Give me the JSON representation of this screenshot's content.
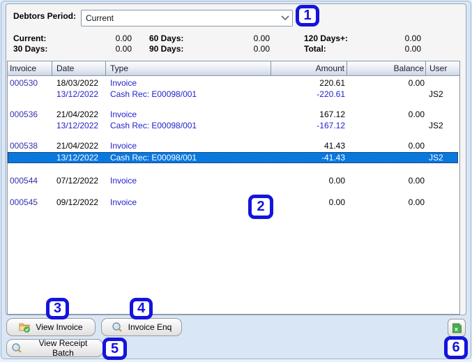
{
  "period_selector": {
    "label": "Debtors Period:",
    "value": "Current",
    "chevron_icon": "chevron-down-icon"
  },
  "summary": {
    "rows": [
      [
        {
          "label": "Current:",
          "value": "0.00"
        },
        {
          "label": "60 Days:",
          "value": "0.00"
        },
        {
          "label": "120 Days+:",
          "value": "0.00"
        }
      ],
      [
        {
          "label": "30 Days:",
          "value": "0.00"
        },
        {
          "label": "90 Days:",
          "value": "0.00"
        },
        {
          "label": "Total:",
          "value": "0.00"
        }
      ]
    ]
  },
  "table": {
    "columns": [
      "Invoice",
      "Date",
      "Type",
      "Amount",
      "Balance",
      "User"
    ],
    "rows": [
      {
        "invoice": "000530",
        "date": "18/03/2022",
        "type": "Invoice",
        "amount": "220.61",
        "balance": "0.00",
        "user": ""
      },
      {
        "invoice": "",
        "date": "13/12/2022",
        "type": "Cash Rec: E00098/001",
        "amount": "-220.61",
        "balance": "",
        "user": "JS2"
      },
      {
        "invoice": "000536",
        "date": "21/04/2022",
        "type": "Invoice",
        "amount": "167.12",
        "balance": "0.00",
        "user": ""
      },
      {
        "invoice": "",
        "date": "13/12/2022",
        "type": "Cash Rec: E00098/001",
        "amount": "-167.12",
        "balance": "",
        "user": "JS2"
      },
      {
        "invoice": "000538",
        "date": "21/04/2022",
        "type": "Invoice",
        "amount": "41.43",
        "balance": "0.00",
        "user": ""
      },
      {
        "invoice": "",
        "date": "13/12/2022",
        "type": "Cash Rec: E00098/001",
        "amount": "-41.43",
        "balance": "",
        "user": "JS2"
      },
      {
        "invoice": "000544",
        "date": "07/12/2022",
        "type": "Invoice",
        "amount": "0.00",
        "balance": "0.00",
        "user": ""
      },
      {
        "invoice": "000545",
        "date": "09/12/2022",
        "type": "Invoice",
        "amount": "0.00",
        "balance": "0.00",
        "user": ""
      }
    ],
    "selected_row_index": 5
  },
  "buttons": {
    "view_invoice": "View Invoice",
    "invoice_enq": "Invoice Enq",
    "view_receipt_batch": "View Receipt Batch",
    "export_excel_icon": "excel-export-icon"
  },
  "annotations": {
    "badges": [
      "1",
      "2",
      "3",
      "4",
      "5",
      "6"
    ]
  },
  "colors": {
    "badge_blue": "#1414dd",
    "selection_blue": "#0a77dd",
    "link_blue": "#2222cc",
    "invoice_navy": "#3333aa",
    "panel_bg": "#f5f5f5",
    "dialog_bg": "#d9e6f5"
  }
}
